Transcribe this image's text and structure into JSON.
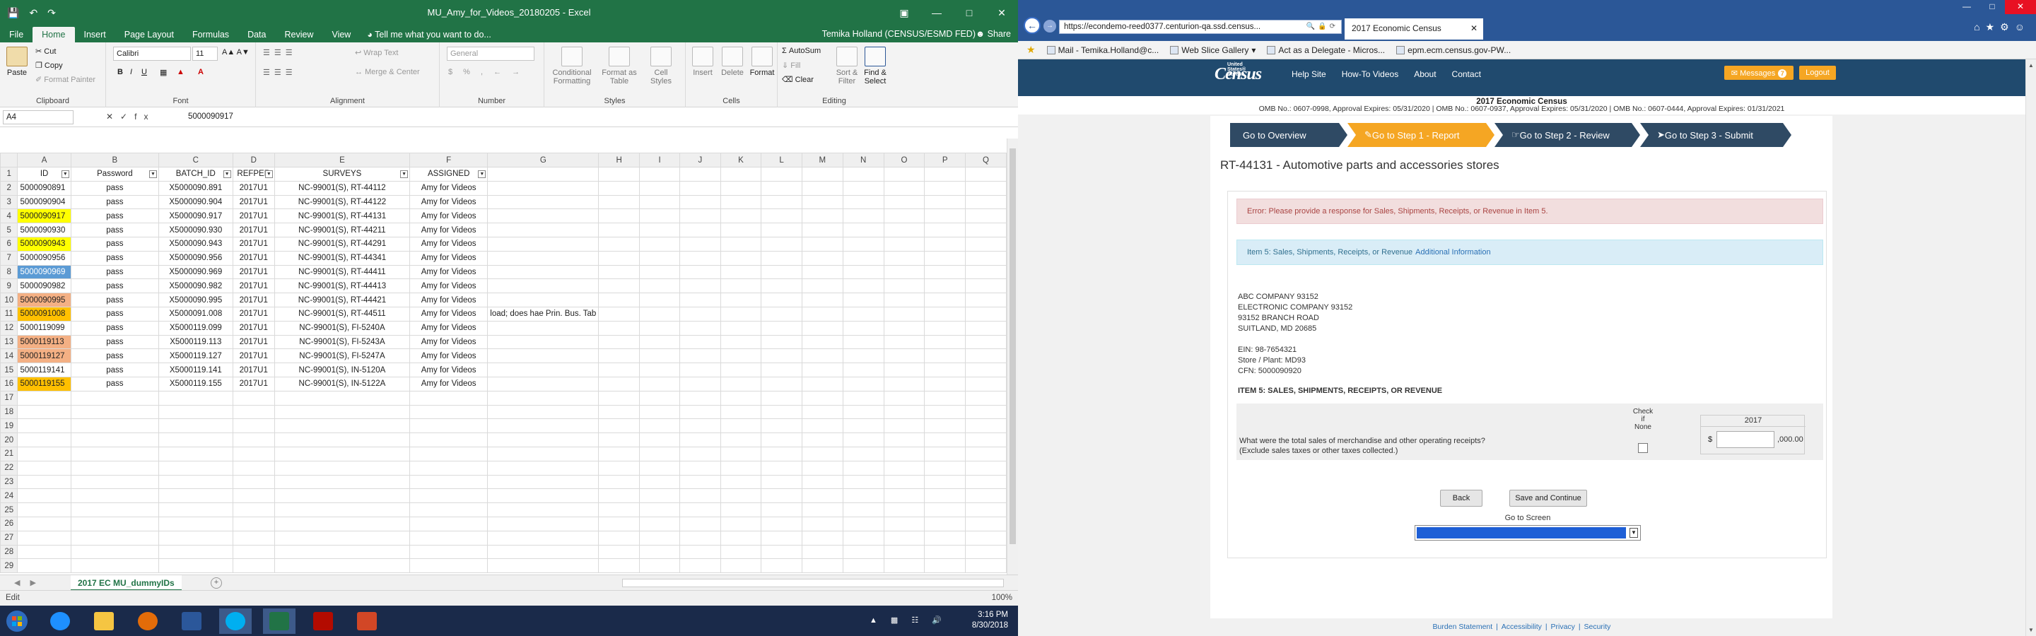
{
  "excel": {
    "title": "MU_Amy_for_Videos_20180205 - Excel",
    "tabs": [
      "File",
      "Home",
      "Insert",
      "Page Layout",
      "Formulas",
      "Data",
      "Review",
      "View"
    ],
    "active_tab": "Home",
    "tell_me": "Tell me what you want to do...",
    "user": "Temika Holland (CENSUS/ESMD FED)",
    "share": "Share",
    "ribbon": {
      "paste": "Paste",
      "cut": "Cut",
      "copy": "Copy",
      "format_painter": "Format Painter",
      "clipboard": "Clipboard",
      "font_name": "Calibri",
      "font_size": "11",
      "font": "Font",
      "wrap_text": "Wrap Text",
      "merge_center": "Merge & Center",
      "alignment": "Alignment",
      "number_format": "General",
      "number": "Number",
      "conditional_formatting": "Conditional Formatting",
      "format_as_table": "Format as Table",
      "cell_styles": "Cell Styles",
      "styles": "Styles",
      "insert": "Insert",
      "delete": "Delete",
      "format": "Format",
      "cells": "Cells",
      "autosum": "AutoSum",
      "fill": "Fill",
      "clear": "Clear",
      "sort_filter": "Sort & Filter",
      "find_select": "Find & Select",
      "editing": "Editing"
    },
    "name_box": "A4",
    "formula_value": "5000090917",
    "columns": [
      "A",
      "B",
      "C",
      "D",
      "E",
      "F",
      "G",
      "H",
      "I",
      "J",
      "K",
      "L",
      "M",
      "N",
      "O",
      "P",
      "Q"
    ],
    "header_row": [
      "ID",
      "Password",
      "BATCH_ID",
      "REFPER",
      "SURVEYS",
      "ASSIGNED"
    ],
    "rows": [
      {
        "n": "2",
        "id": "5000090891",
        "pw": "pass",
        "batch": "X5000090.891",
        "ref": "2017U1",
        "survey": "NC-99001(S), RT-44112",
        "assigned": "Amy for Videos",
        "hl": ""
      },
      {
        "n": "3",
        "id": "5000090904",
        "pw": "pass",
        "batch": "X5000090.904",
        "ref": "2017U1",
        "survey": "NC-99001(S), RT-44122",
        "assigned": "Amy for Videos",
        "hl": ""
      },
      {
        "n": "4",
        "id": "5000090917",
        "pw": "pass",
        "batch": "X5000090.917",
        "ref": "2017U1",
        "survey": "NC-99001(S), RT-44131",
        "assigned": "Amy for Videos",
        "hl": "yel"
      },
      {
        "n": "5",
        "id": "5000090930",
        "pw": "pass",
        "batch": "X5000090.930",
        "ref": "2017U1",
        "survey": "NC-99001(S), RT-44211",
        "assigned": "Amy for Videos",
        "hl": ""
      },
      {
        "n": "6",
        "id": "5000090943",
        "pw": "pass",
        "batch": "X5000090.943",
        "ref": "2017U1",
        "survey": "NC-99001(S), RT-44291",
        "assigned": "Amy for Videos",
        "hl": "yel"
      },
      {
        "n": "7",
        "id": "5000090956",
        "pw": "pass",
        "batch": "X5000090.956",
        "ref": "2017U1",
        "survey": "NC-99001(S), RT-44341",
        "assigned": "Amy for Videos",
        "hl": ""
      },
      {
        "n": "8",
        "id": "5000090969",
        "pw": "pass",
        "batch": "X5000090.969",
        "ref": "2017U1",
        "survey": "NC-99001(S), RT-44411",
        "assigned": "Amy for Videos",
        "hl": "sel"
      },
      {
        "n": "9",
        "id": "5000090982",
        "pw": "pass",
        "batch": "X5000090.982",
        "ref": "2017U1",
        "survey": "NC-99001(S), RT-44413",
        "assigned": "Amy for Videos",
        "hl": ""
      },
      {
        "n": "10",
        "id": "5000090995",
        "pw": "pass",
        "batch": "X5000090.995",
        "ref": "2017U1",
        "survey": "NC-99001(S), RT-44421",
        "assigned": "Amy for Videos",
        "hl": "org"
      },
      {
        "n": "11",
        "id": "5000091008",
        "pw": "pass",
        "batch": "X5000091.008",
        "ref": "2017U1",
        "survey": "NC-99001(S), RT-44511",
        "assigned": "Amy for Videos",
        "hl": "org2",
        "note": "load; does hae Prin. Bus. Tab"
      },
      {
        "n": "12",
        "id": "5000119099",
        "pw": "pass",
        "batch": "X5000119.099",
        "ref": "2017U1",
        "survey": "NC-99001(S), FI-5240A",
        "assigned": "Amy for Videos",
        "hl": ""
      },
      {
        "n": "13",
        "id": "5000119113",
        "pw": "pass",
        "batch": "X5000119.113",
        "ref": "2017U1",
        "survey": "NC-99001(S), FI-5243A",
        "assigned": "Amy for Videos",
        "hl": "org"
      },
      {
        "n": "14",
        "id": "5000119127",
        "pw": "pass",
        "batch": "X5000119.127",
        "ref": "2017U1",
        "survey": "NC-99001(S), FI-5247A",
        "assigned": "Amy for Videos",
        "hl": "org"
      },
      {
        "n": "15",
        "id": "5000119141",
        "pw": "pass",
        "batch": "X5000119.141",
        "ref": "2017U1",
        "survey": "NC-99001(S), IN-5120A",
        "assigned": "Amy for Videos",
        "hl": ""
      },
      {
        "n": "16",
        "id": "5000119155",
        "pw": "pass",
        "batch": "X5000119.155",
        "ref": "2017U1",
        "survey": "NC-99001(S), IN-5122A",
        "assigned": "Amy for Videos",
        "hl": "org2"
      }
    ],
    "empty_rows": [
      "17",
      "18",
      "19",
      "20",
      "21",
      "22",
      "23",
      "24",
      "25",
      "26",
      "27",
      "28",
      "29"
    ],
    "sheet_tab": "2017 EC MU_dummyIDs",
    "status": "Edit",
    "zoom": "100%"
  },
  "browser": {
    "url": "https://econdemo-reed0377.centurion-qa.ssd.census...",
    "tab_title": "2017 Economic Census",
    "favorites": [
      "Mail - Temika.Holland@c...",
      "Web Slice Gallery",
      "Act as a Delegate - Micros...",
      "epm.ecm.census.gov-PW..."
    ],
    "census": {
      "logo": "Census",
      "logo_small": "United States® Bureau",
      "nav": [
        "Help Site",
        "How-To Videos",
        "About",
        "Contact"
      ],
      "messages": "Messages",
      "messages_count": "7",
      "logout": "Logout",
      "subtitle": "2017 Economic Census",
      "omb": "OMB No.: 0607-0998, Approval Expires: 05/31/2020  |  OMB No.: 0607-0937, Approval Expires: 05/31/2020  |  OMB No.: 0607-0444, Approval Expires: 01/31/2021",
      "steps": [
        "Go to Overview",
        "Go to Step 1 - Report",
        "Go to Step 2 - Review",
        "Go to Step 3 - Submit"
      ],
      "form_title": "RT-44131 - Automotive parts and accessories stores",
      "error": "Error: Please provide a response for Sales, Shipments, Receipts, or Revenue in Item 5.",
      "info": "Item 5: Sales, Shipments, Receipts, or Revenue",
      "info_link": "Additional Information",
      "address": [
        "ABC COMPANY 93152",
        "ELECTRONIC COMPANY 93152",
        "93152 BRANCH ROAD",
        "SUITLAND, MD 20685",
        "",
        "EIN: 98-7654321",
        "Store / Plant: MD93",
        "CFN: 5000090920"
      ],
      "item_heading": "ITEM 5: SALES, SHIPMENTS, RECEIPTS, OR REVENUE",
      "question": "What were the total sales of merchandise and other operating receipts?",
      "question_note": "(Exclude sales taxes or other taxes collected.)",
      "check_label": "Check if None",
      "year": "2017",
      "currency": "$",
      "suffix": ",000.00",
      "back": "Back",
      "save": "Save and Continue",
      "go_to_screen": "Go to Screen",
      "footer": [
        "Burden Statement",
        "Accessibility",
        "Privacy",
        "Security"
      ]
    }
  },
  "taskbar": {
    "time": "3:16 PM",
    "date": "8/30/2018"
  }
}
